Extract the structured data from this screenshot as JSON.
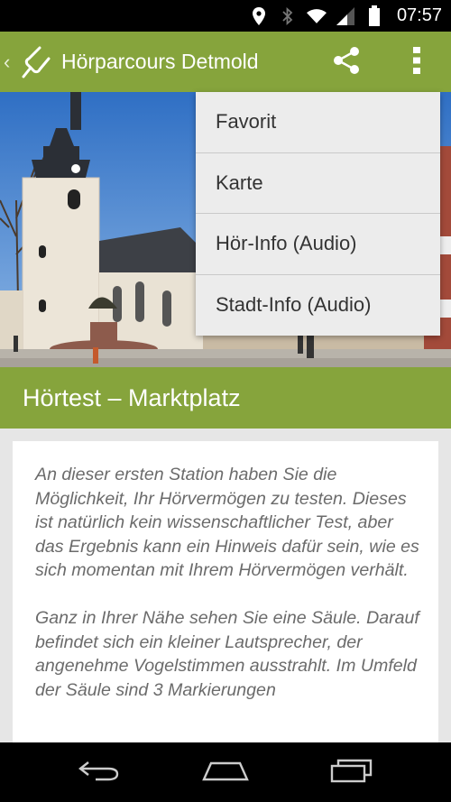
{
  "status_bar": {
    "time": "07:57",
    "icons": [
      "location-icon",
      "bluetooth-icon",
      "wifi-icon",
      "signal-icon",
      "battery-icon"
    ]
  },
  "action_bar": {
    "title": "Hörparcours Detmold",
    "icons": [
      "up-caret-icon",
      "app-logo-icon",
      "share-icon",
      "overflow-menu-icon"
    ],
    "accent_color": "#86a43c"
  },
  "menu": {
    "items": [
      {
        "label": "Favorit"
      },
      {
        "label": "Karte"
      },
      {
        "label": "Hör-Info (Audio)"
      },
      {
        "label": "Stadt-Info (Audio)"
      }
    ]
  },
  "station": {
    "title": "Hörtest – Marktplatz"
  },
  "content": {
    "paragraphs": [
      "An dieser ersten Station haben Sie die Möglichkeit, Ihr Hörvermögen zu testen. Dieses ist natürlich kein wissenschaftlicher Test, aber das Ergebnis kann ein Hinweis dafür sein, wie es sich momentan mit Ihrem Hörvermögen verhält.",
      "Ganz in Ihrer Nähe sehen Sie eine Säule. Darauf befindet sich ein kleiner Lautsprecher, der angenehme Vogelstimmen ausstrahlt. Im Umfeld der Säule sind 3 Markierungen"
    ]
  },
  "nav_bar": {
    "icons": [
      "back-icon",
      "home-icon",
      "recents-icon"
    ]
  }
}
